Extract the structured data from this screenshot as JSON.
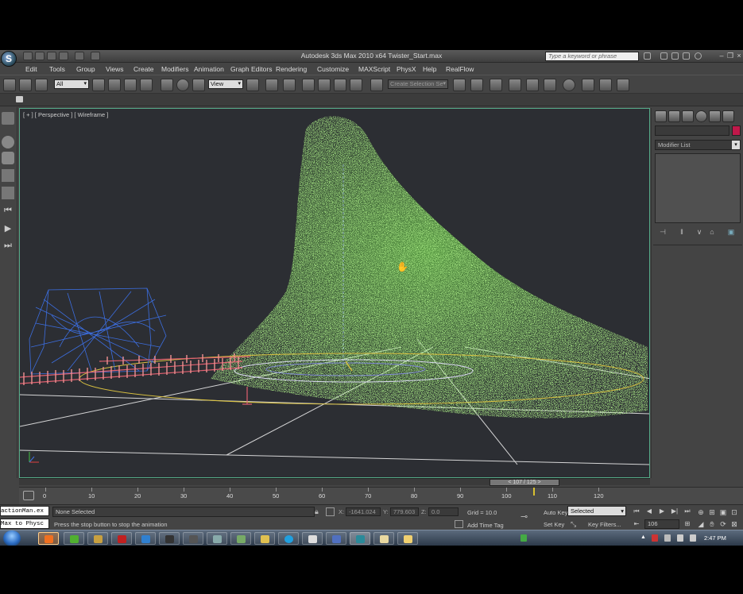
{
  "window": {
    "title": "Autodesk 3ds Max  2010 x64       Twister_Start.max",
    "search_placeholder": "Type a keyword or phrase",
    "logo_letter": "S"
  },
  "menu": [
    "Edit",
    "Tools",
    "Group",
    "Views",
    "Create",
    "Modifiers",
    "Animation",
    "Graph Editors",
    "Rendering",
    "Customize",
    "MAXScript",
    "PhysX",
    "Help",
    "RealFlow"
  ],
  "toolbar": {
    "selection_filter": "All",
    "reference_coord": "View",
    "named_selection": "Create Selection Se"
  },
  "viewport": {
    "label": "[ + ] [ Perspective ] [ Wireframe ]",
    "border_color": "#5aa06a",
    "particle_color": "#6ee040",
    "box_color": "#3c6ee0"
  },
  "command_panel": {
    "modifier_list": "Modifier List",
    "object_color": "#c0184a"
  },
  "timeline": {
    "slider_label": "< 107 / 125 >",
    "current_frame": 107,
    "total_frames": 125,
    "ticks": [
      "0",
      "10",
      "20",
      "30",
      "40",
      "50",
      "60",
      "70",
      "80",
      "90",
      "100",
      "110",
      "120"
    ]
  },
  "status": {
    "listener_1": "actionMan.ex",
    "listener_2": "Max to Physc",
    "selection": "None Selected",
    "prompt": "Press the stop button to stop the animation",
    "x_label": "X:",
    "x_value": "-1641.024",
    "y_label": "Y:",
    "y_value": "779.603",
    "z_label": "Z:",
    "z_value": "0.0",
    "grid": "Grid = 10.0",
    "add_time_tag": "Add Time Tag",
    "auto_key": "Auto Key",
    "set_key": "Set Key",
    "key_mode": "Selected",
    "key_filters": "Key Filters...",
    "frame_value": "106"
  },
  "taskbar": {
    "clock": "2:47 PM"
  }
}
